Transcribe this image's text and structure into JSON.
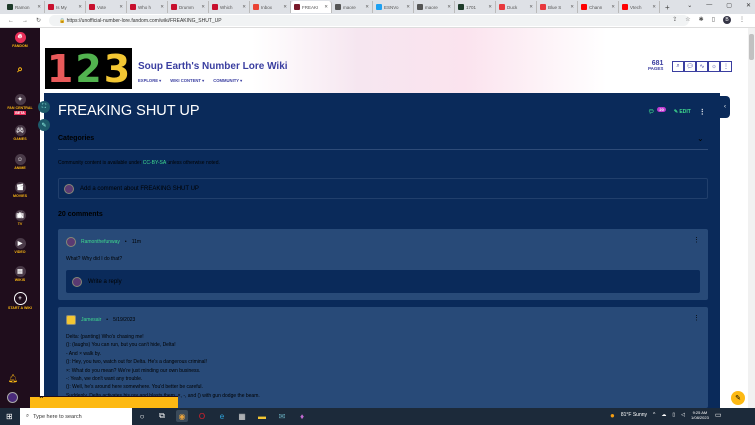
{
  "browser": {
    "tabs": [
      {
        "label": "Ramon",
        "color": "#1d3b2a"
      },
      {
        "label": "Is My",
        "color": "#c8102e"
      },
      {
        "label": "Vote",
        "color": "#c8102e"
      },
      {
        "label": "Who h",
        "color": "#c8102e"
      },
      {
        "label": "Drumm",
        "color": "#c8102e"
      },
      {
        "label": "Which",
        "color": "#c8102e"
      },
      {
        "label": "Inbox",
        "color": "#ea4335"
      },
      {
        "label": "FREAKI",
        "color": "#7a1a2a",
        "active": true
      },
      {
        "label": "maore",
        "color": "#555"
      },
      {
        "label": "ESNVo",
        "color": "#1da1f2"
      },
      {
        "label": "maore",
        "color": "#555"
      },
      {
        "label": "1701",
        "color": "#1d3b2a"
      },
      {
        "label": "Duck",
        "color": "#e8383d"
      },
      {
        "label": "Blue S",
        "color": "#e8383d"
      },
      {
        "label": "Chann",
        "color": "#ff0000"
      },
      {
        "label": "Vtech",
        "color": "#ff0000"
      }
    ],
    "url": "https://unofficial-number-lore.fandom.com/wiki/FREAKING_SHUT_UP",
    "profile_initial": "B"
  },
  "rail": {
    "items": [
      {
        "label": "FANDOM",
        "icon": "fandom-flame-icon"
      },
      {
        "label": "",
        "icon": "search-icon"
      },
      {
        "label": "FAN CENTRAL",
        "badge": "BETA",
        "icon": "fan-central-icon"
      },
      {
        "label": "GAMES",
        "icon": "games-icon"
      },
      {
        "label": "ANIME",
        "icon": "anime-icon"
      },
      {
        "label": "MOVIES",
        "icon": "movies-icon"
      },
      {
        "label": "TV",
        "icon": "tv-icon"
      },
      {
        "label": "VIDEO",
        "icon": "video-icon"
      },
      {
        "label": "WIKIS",
        "icon": "wikis-icon"
      },
      {
        "label": "START A WIKI",
        "icon": "plus-circle-icon"
      }
    ]
  },
  "wiki": {
    "logo_digits": [
      "1",
      "2",
      "3"
    ],
    "title": "Soup Earth's Number Lore Wiki",
    "nav": [
      "EXPLORE",
      "WIKI CONTENT",
      "COMMUNITY"
    ],
    "pages_count": "681",
    "pages_label": "PAGES"
  },
  "page": {
    "title": "FREAKING SHUT UP",
    "comment_badge": "20",
    "edit_label": "EDIT",
    "categories_label": "Categories",
    "license_prefix": "Community content is available under ",
    "license_link": "CC-BY-SA",
    "license_suffix": " unless otherwise noted.",
    "add_comment": "Add a comment about FREAKING SHUT UP",
    "comments_count": "20 comments",
    "comments": [
      {
        "author": "Ramonthefunway",
        "time": "11m",
        "lines": [
          "What? Why did I do that?"
        ],
        "reply_placeholder": "Write a reply"
      },
      {
        "author": "Jamesair",
        "time": "5/19/2023",
        "lines": [
          "Delta: (panting) Who's chasing me!",
          "(): (laughs) You can run, but you can't hide, Delta!",
          "- And × walk by.",
          "(): Hey, you two, watch out for Delta. He's a dangerous criminal!",
          "×: What do you mean? We're just minding our own business.",
          "-: Yeah, we don't want any trouble.",
          "(): Well, he's around here somewhere. You'd better be careful.",
          "Suddenly, Delta activates his ray and blasts them. ×, -, and () with gun dodge the beam."
        ]
      }
    ]
  },
  "taskbar": {
    "search_placeholder": "Type here to search",
    "weather": "81°F  Sunny",
    "time": "9:25 AM",
    "date": "1/08/2023"
  },
  "colors": {
    "accent": "#3fdb8e",
    "fandom": "#fdb913",
    "main_bg": "#0a2a5a",
    "comment_bg": "#284a78"
  }
}
